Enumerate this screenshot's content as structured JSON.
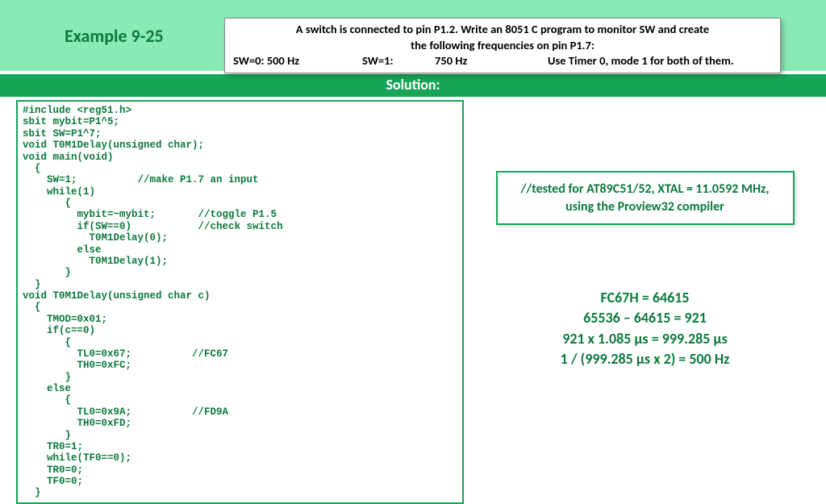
{
  "header": {
    "example_label": "Example 9-25",
    "problem_line1": "A switch is connected to pin P1.2.  Write an 8051 C program to monitor SW and create",
    "problem_line2": "the following frequencies on pin P1.7:",
    "problem_sw0": "SW=0: 500 Hz",
    "problem_sw1a": "SW=1:",
    "problem_sw1b": "750 Hz",
    "problem_hint": "Use Timer 0, mode 1 for both of them."
  },
  "solution_label": "Solution:",
  "code": "#include <reg51.h>\nsbit mybit=P1^5;\nsbit SW=P1^7;\nvoid T0M1Delay(unsigned char);\nvoid main(void)\n  {\n    SW=1;          //make P1.7 an input\n    while(1)\n       {\n         mybit=~mybit;       //toggle P1.5\n         if(SW==0)           //check switch\n           T0M1Delay(0);\n         else\n           T0M1Delay(1);\n       }\n  }\nvoid T0M1Delay(unsigned char c)\n  {\n    TMOD=0x01;\n    if(c==0)\n       {\n         TL0=0x67;          //FC67\n         TH0=0xFC;\n       }\n    else\n       {\n         TL0=0x9A;          //FD9A\n         TH0=0xFD;\n       }\n    TR0=1;\n    while(TF0==0);\n    TR0=0;\n    TF0=0;\n  }",
  "note": {
    "line1": "//tested for AT89C51/52, XTAL = 11.0592 MHz,",
    "line2": "using the Proview32 compiler"
  },
  "calc": {
    "l1": "FC67H = 64615",
    "l2": "65536 – 64615 = 921",
    "l3": "921 x 1.085 μs = 999.285 μs",
    "l4": "1 / (999.285 μs x 2) = 500 Hz"
  }
}
